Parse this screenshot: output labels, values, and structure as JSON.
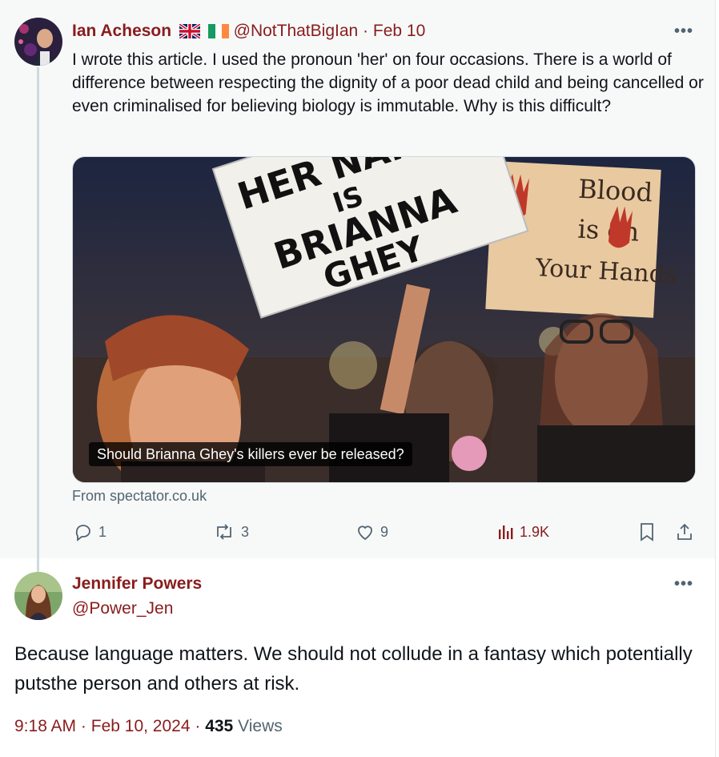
{
  "parent_tweet": {
    "author_name": "Ian Acheson",
    "handle": "@NotThatBigIan",
    "separator": "·",
    "date": "Feb 10",
    "text": "I wrote this article. I used the pronoun 'her' on four occasions. There is a world of difference between respecting the dignity of a poor dead child and being cancelled or even criminalised for believing biology is immutable. Why is this difficult?",
    "card": {
      "caption": "Should Brianna Ghey's killers ever be released?",
      "sign_text": "HER NAME IS BRIANNA GHEY",
      "sign2_text": "Our Blood is on Your Hands",
      "source": "From spectator.co.uk"
    },
    "actions": {
      "replies": "1",
      "reposts": "3",
      "likes": "9",
      "views": "1.9K"
    }
  },
  "reply_tweet": {
    "author_name": "Jennifer Powers",
    "handle": "@Power_Jen",
    "text": "Because language matters. We should not collude in a fantasy which potentially putsthe person and others at risk.",
    "time": "9:18 AM",
    "dot": "·",
    "date": "Feb 10, 2024",
    "views_count": "435",
    "views_label": "Views"
  },
  "more_label": "•••",
  "colors": {
    "accent": "#8a1c1c",
    "muted": "#536471",
    "line": "#cfd9de"
  }
}
